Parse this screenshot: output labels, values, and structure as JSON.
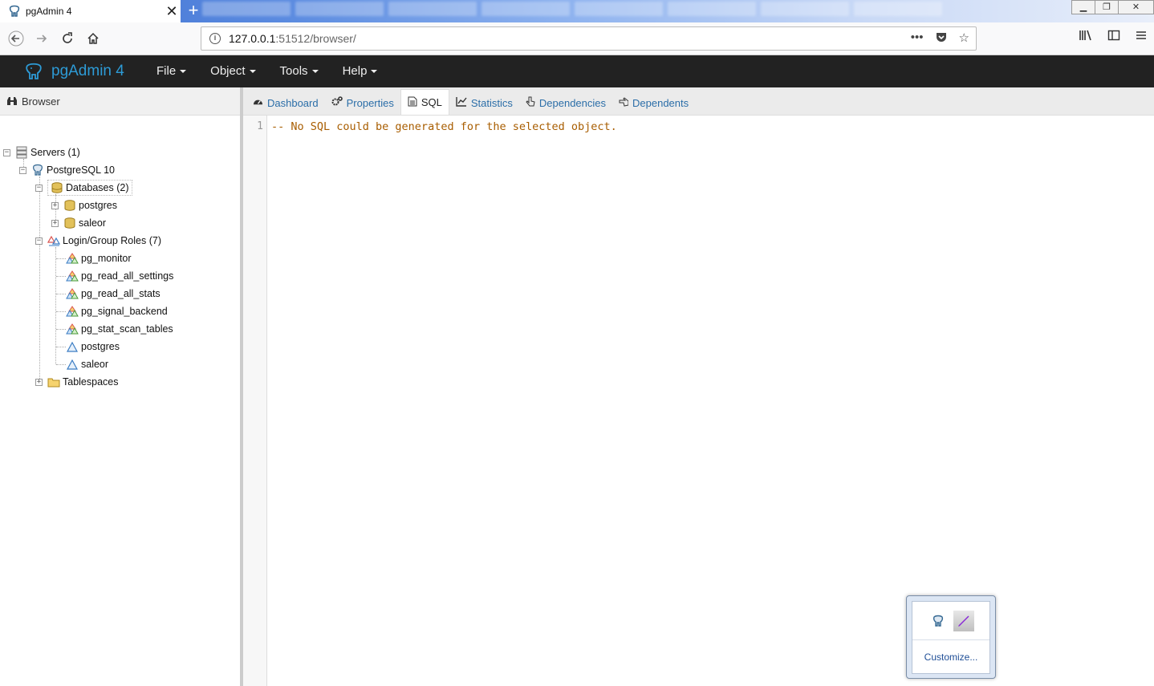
{
  "browser": {
    "tab_title": "pgAdmin 4",
    "url_host": "127.0.0.1",
    "url_rest": ":51512/browser/"
  },
  "app": {
    "brand": "pgAdmin 4",
    "menu": [
      {
        "label": "File"
      },
      {
        "label": "Object"
      },
      {
        "label": "Tools"
      },
      {
        "label": "Help"
      }
    ]
  },
  "browser_panel": {
    "title": "Browser",
    "tree": {
      "servers": "Servers (1)",
      "server": "PostgreSQL 10",
      "databases": "Databases (2)",
      "db_items": [
        "postgres",
        "saleor"
      ],
      "roles": "Login/Group Roles (7)",
      "role_items": [
        "pg_monitor",
        "pg_read_all_settings",
        "pg_read_all_stats",
        "pg_signal_backend",
        "pg_stat_scan_tables",
        "postgres",
        "saleor"
      ],
      "tablespaces": "Tablespaces"
    }
  },
  "main_panel": {
    "tabs": [
      {
        "label": "Dashboard",
        "icon": "dashboard-icon"
      },
      {
        "label": "Properties",
        "icon": "gears-icon"
      },
      {
        "label": "SQL",
        "icon": "file-text-icon"
      },
      {
        "label": "Statistics",
        "icon": "line-chart-icon"
      },
      {
        "label": "Dependencies",
        "icon": "hand-pointer-icon"
      },
      {
        "label": "Dependents",
        "icon": "hand-pointer-icon"
      }
    ],
    "active_tab": "SQL",
    "editor": {
      "line_number": "1",
      "code": "-- No SQL could be generated for the selected object."
    }
  },
  "tray_popup": {
    "customize_label": "Customize..."
  },
  "colors": {
    "header_bg": "#222222",
    "brand": "#2d9bd6",
    "link": "#2b6ea8",
    "sql_comment": "#a85d00"
  }
}
